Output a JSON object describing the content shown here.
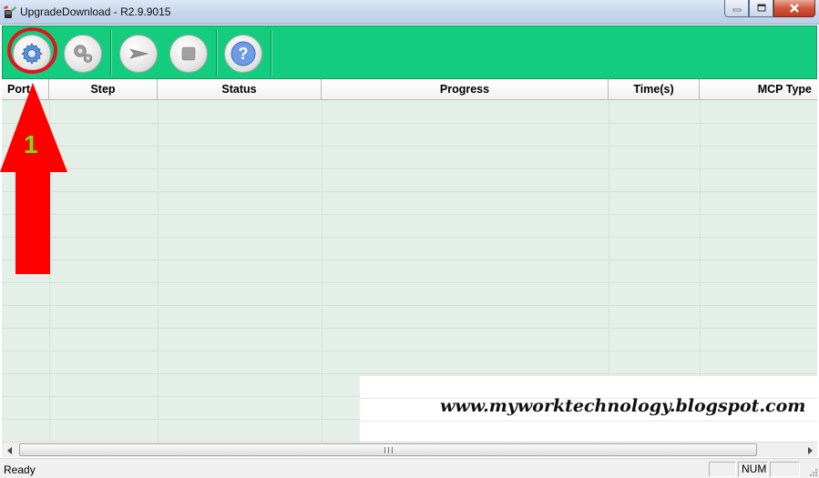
{
  "window": {
    "title": "UpgradeDownload  -  R2.9.9015",
    "app_icon": "phone-app-icon",
    "controls": [
      "minimize-icon",
      "maximize-icon",
      "close-icon"
    ]
  },
  "toolbar": {
    "background": "#14cc7e",
    "buttons": [
      {
        "icon": "gear-icon",
        "name": "settings"
      },
      {
        "icon": "gears-icon",
        "name": "advanced-settings"
      },
      {
        "icon": "play-arrow-icon",
        "name": "start"
      },
      {
        "icon": "stop-icon",
        "name": "stop"
      },
      {
        "icon": "question-icon",
        "name": "help"
      }
    ]
  },
  "table": {
    "columns": [
      "Port",
      "Step",
      "Status",
      "Progress",
      "Time(s)",
      "MCP Type"
    ],
    "rows": []
  },
  "annotation": {
    "number": "1",
    "arrow_color": "#ff0000",
    "number_color": "#6fe21a"
  },
  "watermark": "www.myworktechnology.blogspot.com",
  "statusbar": {
    "text": "Ready",
    "num_lock": "NUM"
  }
}
